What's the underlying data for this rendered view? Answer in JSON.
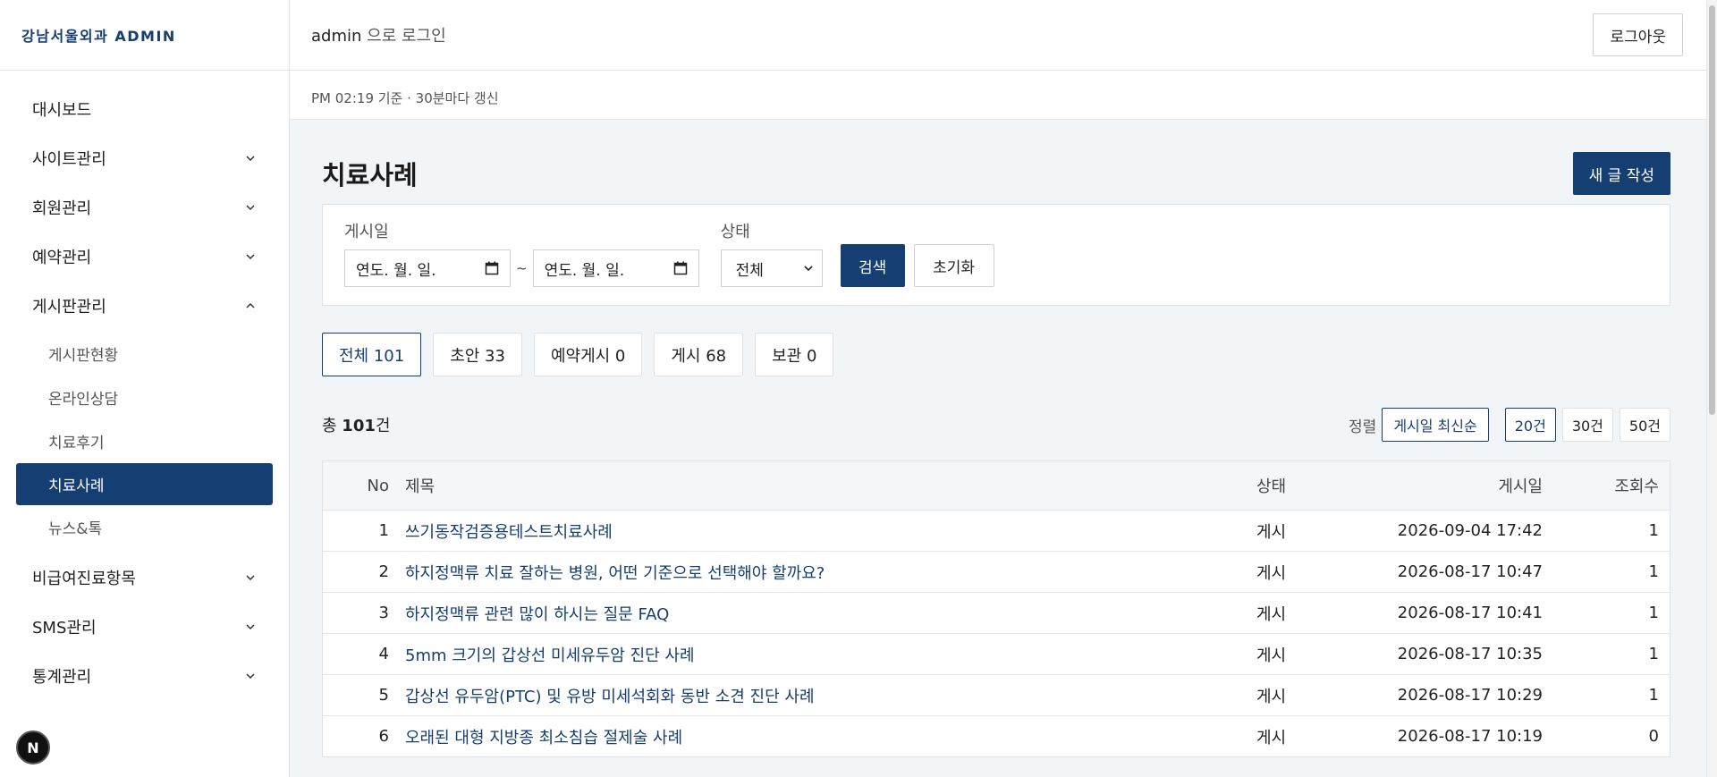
{
  "brand": "강남서울외과 ADMIN",
  "sidebar": {
    "items": [
      {
        "label": "대시보드"
      },
      {
        "label": "사이트관리"
      },
      {
        "label": "회원관리"
      },
      {
        "label": "예약관리"
      },
      {
        "label": "게시판관리"
      },
      {
        "label": "비급여진료항목"
      },
      {
        "label": "SMS관리"
      },
      {
        "label": "통계관리"
      }
    ],
    "board_sub": [
      "게시판현황",
      "온라인상담",
      "치료후기",
      "치료사례",
      "뉴스&톡"
    ],
    "active_sub": "치료사례",
    "badge": "N"
  },
  "topbar": {
    "user": "admin",
    "login_suffix": " 으로 로그인",
    "logout": "로그아웃"
  },
  "subbar": {
    "meta": "PM 02:19 기준 · 30분마다 갱신"
  },
  "page": {
    "title": "치료사례",
    "new_button": "새 글 작성"
  },
  "filter": {
    "date_label": "게시일",
    "date_placeholder": "연도. 월. 일.",
    "tilde": "~",
    "status_label": "상태",
    "status_value": "전체",
    "search": "검색",
    "reset": "초기화"
  },
  "tabs": [
    "전체 101",
    "초안 33",
    "예약게시 0",
    "게시 68",
    "보관 0"
  ],
  "list": {
    "total_prefix": "총 ",
    "total_count": "101",
    "total_suffix": "건",
    "sort_label": "정렬",
    "sort_value": "게시일 최신순",
    "page_sizes": [
      "20건",
      "30건",
      "50건"
    ]
  },
  "table": {
    "columns": [
      "No",
      "제목",
      "상태",
      "게시일",
      "조회수"
    ],
    "rows": [
      {
        "no": "1",
        "title": "쓰기동작검증용테스트치료사례",
        "status": "게시",
        "date": "2026-09-04 17:42",
        "views": "1"
      },
      {
        "no": "2",
        "title": "하지정맥류 치료 잘하는 병원, 어떤 기준으로 선택해야 할까요?",
        "status": "게시",
        "date": "2026-08-17 10:47",
        "views": "1"
      },
      {
        "no": "3",
        "title": "하지정맥류 관련 많이 하시는 질문 FAQ",
        "status": "게시",
        "date": "2026-08-17 10:41",
        "views": "1"
      },
      {
        "no": "4",
        "title": "5mm 크기의 갑상선 미세유두암 진단 사례",
        "status": "게시",
        "date": "2026-08-17 10:35",
        "views": "1"
      },
      {
        "no": "5",
        "title": "갑상선 유두암(PTC) 및 유방 미세석회화 동반 소견 진단 사례",
        "status": "게시",
        "date": "2026-08-17 10:29",
        "views": "1"
      },
      {
        "no": "6",
        "title": "오래된 대형 지방종 최소침습 절제술 사례",
        "status": "게시",
        "date": "2026-08-17 10:19",
        "views": "0"
      }
    ]
  }
}
